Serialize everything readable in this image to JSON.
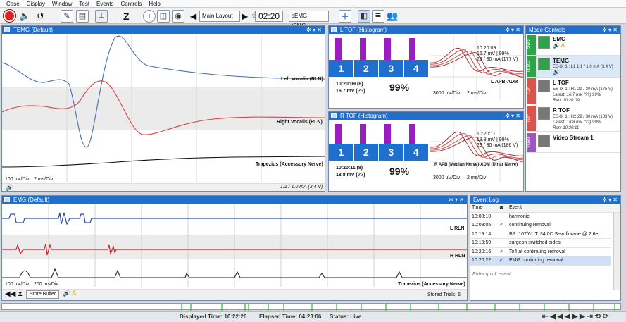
{
  "menu": [
    "Case",
    "Display",
    "Window",
    "Test",
    "Events",
    "Controls",
    "Help"
  ],
  "toolbar": {
    "layout": "Main Layout",
    "time": "02:20",
    "modes": "sEMG, tEMG,"
  },
  "temg": {
    "title": "TEMG (Default)",
    "ch1": "Left Vocalis (RLN)",
    "ch2": "Right Vocalis (RLN)",
    "ch3": "Trapezius (Accessory Nerve)",
    "scale": "100 µV/Div",
    "time": "2 ms/Div",
    "stim": "1.1 / 1.0 mA (3.4 V)"
  },
  "ltof": {
    "title": "L TOF (Histogram)",
    "nums": [
      "1",
      "2",
      "3",
      "4"
    ],
    "time": "10:20:09 (8)",
    "mv": "16.7 mV (??)",
    "pct": "99%",
    "scale": "3000 µV/Div",
    "div": "2 ms/Div",
    "r1": "10:20:09",
    "r2": "16.7 mV | 99%",
    "r3": "29 / 30 mA (177 V)",
    "nerve": "L APB-ADM"
  },
  "rtof": {
    "title": "R TOF (Histogram)",
    "nums": [
      "1",
      "2",
      "3",
      "4"
    ],
    "time": "10:20:11 (8)",
    "mv": "18.8 mV (??)",
    "pct": "99%",
    "scale": "3000 µV/Div",
    "div": "2 ms/Div",
    "r1": "10:20:11",
    "r2": "18.8 mV | 99%",
    "r3": "29 / 30 mA (186 V)",
    "nerve": "R APB (Median Nerve)-ADM (Ulnar Nerve)"
  },
  "mode": {
    "title": "Mode Controls",
    "items": [
      {
        "tab": "EMG",
        "name": "EMG",
        "tabcolor": "#2fa24a"
      },
      {
        "tab": "TEMG",
        "name": "TEMG",
        "l1": "ES-IX 1 : L1     1.1 / 1.0 mA (3.4 V)",
        "tabcolor": "#2fa24a"
      },
      {
        "tab": "TOF",
        "name": "L TOF",
        "l1": "ES-IX 1 : H1     29 / 30 mA (175 V)",
        "l2": "Latest: 16.7 mV (??)     99%",
        "l3": "Ran: 10:20:09",
        "tabcolor": "#d9534f"
      },
      {
        "tab": "TOF",
        "name": "R TOF",
        "l1": "ES-IX 1 : H2     29 / 30 mA (183 V)",
        "l2": "Latest: 18.8 mV (??)     99%",
        "l3": "Ran: 10:20:11",
        "tabcolor": "#d9534f"
      },
      {
        "tab": "Video",
        "name": "Video Stream 1",
        "tabcolor": "#9b59b6"
      }
    ]
  },
  "emg": {
    "title": "EMG (Default)",
    "ch1": "L RLN",
    "ch2": "R RLN",
    "ch3": "Trapezius (Accessory Nerve)",
    "scale": "100 µV/Div",
    "time": "200 ms/Div",
    "store": "Store Buffer",
    "trials": "Stored Trials: 5"
  },
  "events": {
    "title": "Event Log",
    "h_time": "Time",
    "h_event": "Event",
    "placeholder": "Enter quick event",
    "rows": [
      {
        "t": "10:08:10",
        "e": "harmonic",
        "c": ""
      },
      {
        "t": "10:08:05",
        "e": "continuing removal",
        "c": "✓"
      },
      {
        "t": "10:19:14",
        "e": "BP: 107/61 T: 34.0C Sevoflurane @ 2.6e",
        "c": ""
      },
      {
        "t": "10:19:59",
        "e": "surgeon switched sides",
        "c": ""
      },
      {
        "t": "10:20:16",
        "e": "To4 at continuing removal",
        "c": "✓"
      },
      {
        "t": "10:20:22",
        "e": "EMG continuing removal",
        "c": "✓"
      }
    ]
  },
  "status": {
    "displayed": "Displayed Time:  10:22:26",
    "elapsed": "Elapsed Time:  04:23:06",
    "state": "Status:  Live"
  }
}
